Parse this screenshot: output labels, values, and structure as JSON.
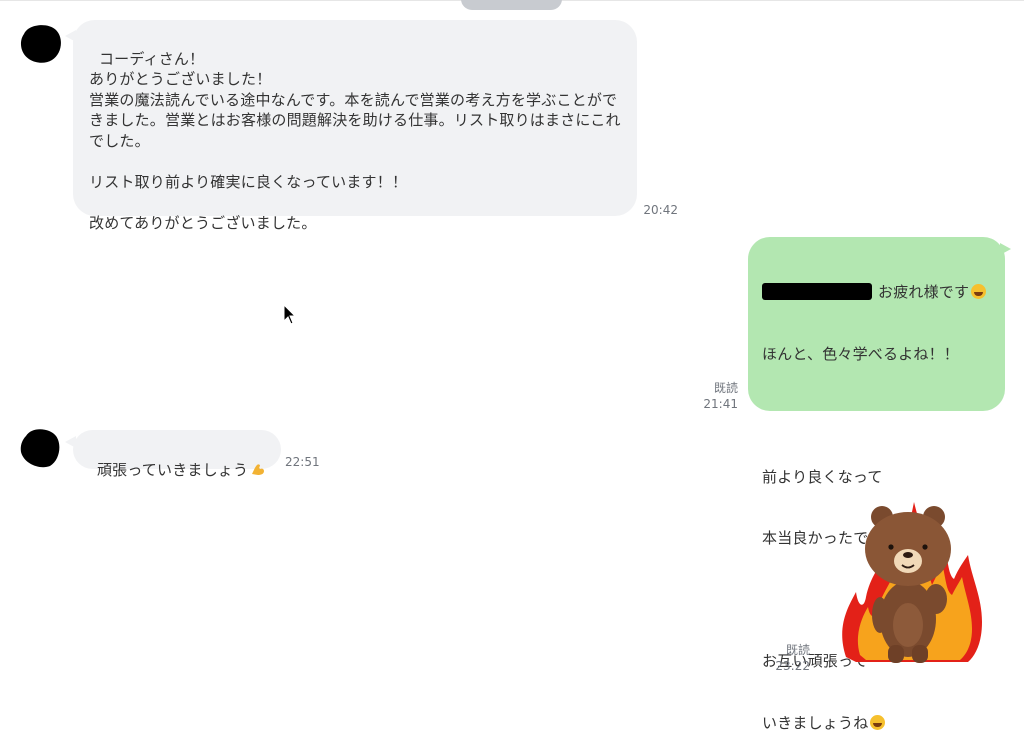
{
  "chat": {
    "messages": [
      {
        "side": "in",
        "text": "コーディさん！\nありがとうございました！\n営業の魔法読んでいる途中なんです。本を読んで営業の考え方を学ぶことができました。営業とはお客様の問題解決を助ける仕事。リスト取りはまさにこれでした。\n\nリスト取り前より確実に良くなっています！！\n\n改めてありがとうございました。",
        "time": "20:42"
      },
      {
        "side": "out",
        "line1": "お疲れ様です",
        "line2": "ほんと、色々学べるよね！！",
        "line3": "前より良くなって",
        "line4": "本当良かったです！！",
        "line5": "お互い頑張って",
        "line6": "いきましょうね",
        "read": "既読",
        "time": "21:41"
      },
      {
        "side": "in",
        "text": "頑張っていきましょう",
        "time": "22:51"
      },
      {
        "side": "out",
        "kind": "sticker",
        "read": "既読",
        "time": "23:22"
      }
    ]
  },
  "colors": {
    "incoming_bubble": "#f1f2f4",
    "outgoing_bubble": "#b3e7b1",
    "meta_text": "#70757d"
  },
  "icons": {
    "avatar": "redacted-avatar",
    "emoji_grin": "grinning-face-emoji",
    "emoji_smile": "smiling-face-emoji",
    "emoji_muscle": "flexed-biceps-emoji",
    "cursor": "mouse-cursor-icon",
    "sticker": "brown-bear-fire-sticker"
  }
}
